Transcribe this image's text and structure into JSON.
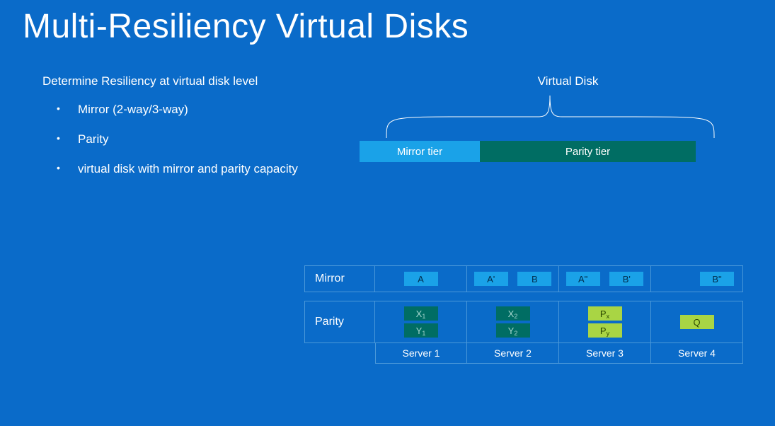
{
  "title": "Multi-Resiliency Virtual Disks",
  "heading": "Determine Resiliency at virtual disk level",
  "bullets": [
    "Mirror (2-way/3-way)",
    "Parity",
    "virtual disk with mirror and parity capacity"
  ],
  "virtual_disk_label": "Virtual Disk",
  "tiers": {
    "mirror": "Mirror tier",
    "parity": "Parity tier"
  },
  "rows": {
    "mirror": "Mirror",
    "parity": "Parity"
  },
  "servers": [
    "Server 1",
    "Server 2",
    "Server 3",
    "Server 4"
  ],
  "mirror_blocks": {
    "s1": [
      "A"
    ],
    "s2": [
      "A'",
      "B"
    ],
    "s3": [
      "A\"",
      "B'"
    ],
    "s4": [
      "B\""
    ]
  },
  "parity_blocks": {
    "s1": [
      {
        "t": "X",
        "s": "1",
        "c": "dark"
      },
      {
        "t": "Y",
        "s": "1",
        "c": "dark"
      }
    ],
    "s2": [
      {
        "t": "X",
        "s": "2",
        "c": "dark"
      },
      {
        "t": "Y",
        "s": "2",
        "c": "dark"
      }
    ],
    "s3": [
      {
        "t": "P",
        "s": "x",
        "c": "light"
      },
      {
        "t": "P",
        "s": "y",
        "c": "light"
      }
    ],
    "s4": [
      {
        "t": "Q",
        "s": "",
        "c": "light"
      }
    ]
  },
  "colors": {
    "bg": "#0a6bc9",
    "mirror_tier": "#1aa2e8",
    "parity_tier": "#006d63",
    "parity_block_light": "#a9d544"
  }
}
